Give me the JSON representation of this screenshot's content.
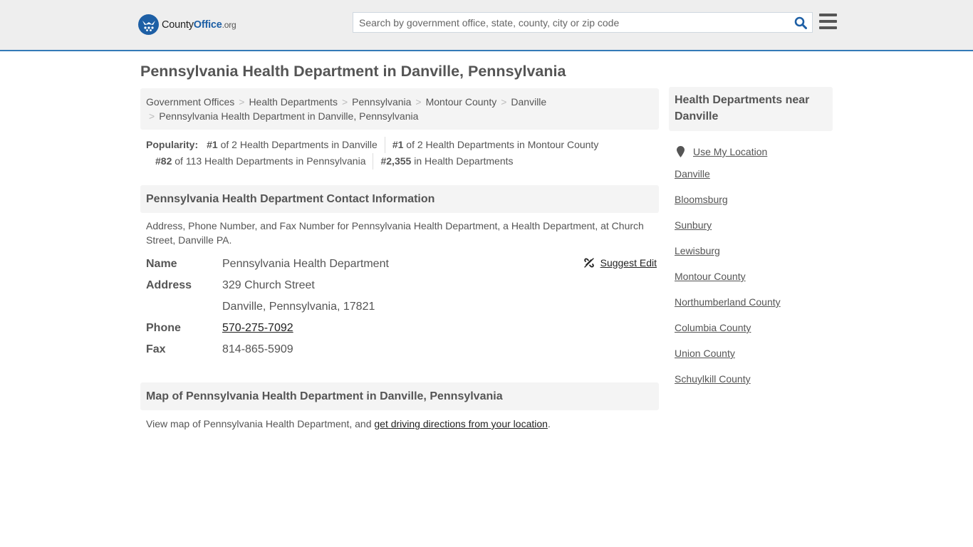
{
  "header": {
    "logo": {
      "brand_prefix": "County",
      "brand_main": "Office",
      "brand_tld": ".org"
    },
    "search": {
      "placeholder": "Search by government office, state, county, city or zip code",
      "value": ""
    },
    "icons": {
      "search": "search-icon",
      "menu": "hamburger-menu-icon"
    },
    "colors": {
      "accent": "#337ab7",
      "brand": "#1d5fa5",
      "header_bg": "#eeeeee"
    }
  },
  "page": {
    "title": "Pennsylvania Health Department in Danville, Pennsylvania"
  },
  "breadcrumb": {
    "items": [
      {
        "label": "Government Offices"
      },
      {
        "label": "Health Departments"
      },
      {
        "label": "Pennsylvania"
      },
      {
        "label": "Montour County"
      },
      {
        "label": "Danville"
      }
    ],
    "current": "Pennsylvania Health Department in Danville, Pennsylvania",
    "separator": ">"
  },
  "popularity": {
    "label": "Popularity:",
    "items": [
      {
        "rank": "#1",
        "text": "of 2 Health Departments in Danville"
      },
      {
        "rank": "#1",
        "text": "of 2 Health Departments in Montour County"
      },
      {
        "rank": "#82",
        "text": "of 113 Health Departments in Pennsylvania"
      },
      {
        "rank": "#2,355",
        "text": "in Health Departments"
      }
    ]
  },
  "contact": {
    "heading": "Pennsylvania Health Department Contact Information",
    "description": "Address, Phone Number, and Fax Number for Pennsylvania Health Department, a Health Department, at Church Street, Danville PA.",
    "suggest_edit": "Suggest Edit",
    "fields": {
      "name_label": "Name",
      "name_value": "Pennsylvania Health Department",
      "address_label": "Address",
      "address_line1": "329 Church Street",
      "address_line2": "Danville, Pennsylvania, 17821",
      "phone_label": "Phone",
      "phone_value": "570-275-7092",
      "fax_label": "Fax",
      "fax_value": "814-865-5909"
    }
  },
  "map": {
    "heading": "Map of Pennsylvania Health Department in Danville, Pennsylvania",
    "text_before": "View map of Pennsylvania Health Department, and ",
    "link": "get driving directions from your location",
    "text_after": "."
  },
  "sidebar": {
    "heading": "Health Departments near Danville",
    "use_location": "Use My Location",
    "links": [
      "Danville",
      "Bloomsburg",
      "Sunbury",
      "Lewisburg",
      "Montour County",
      "Northumberland County",
      "Columbia County",
      "Union County",
      "Schuylkill County"
    ]
  }
}
